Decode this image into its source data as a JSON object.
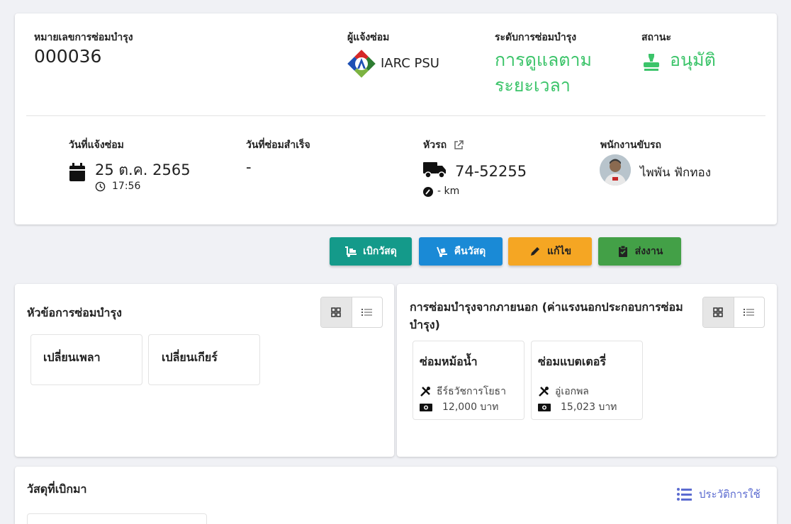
{
  "header": {
    "repair_no_label": "หมายเลขการซ่อมบำรุง",
    "repair_no": "000036",
    "reporter_label": "ผู้แจ้งซ่อม",
    "reporter_name": "IARC PSU",
    "level_label": "ระดับการซ่อมบำรุง",
    "level_line1": "การดูแลตาม",
    "level_line2": "ระยะเวลา",
    "status_label": "สถานะ",
    "status_value": "อนุมัติ",
    "accent": "#3cc46a"
  },
  "details": {
    "report_date_label": "วันที่แจ้งซ่อม",
    "report_date": "25 ต.ค. 2565",
    "report_time": "17:56",
    "done_date_label": "วันที่ซ่อมสำเร็จ",
    "done_date": "-",
    "truck_label": "หัวรถ",
    "truck_plate": "74-52255",
    "truck_km": "- km",
    "driver_label": "พนักงานขับรถ",
    "driver_name": "ไพพัน ฟักทอง"
  },
  "actions": {
    "withdraw": "เบิกวัสดุ",
    "return": "คืนวัสดุ",
    "edit": "แก้ไข",
    "submit": "ส่งงาน",
    "colors": {
      "withdraw": "#149a8a",
      "return": "#1a8ad6",
      "edit": "#f5a623",
      "submit": "#43a047"
    }
  },
  "topics": {
    "title": "หัวข้อการซ่อมบำรุง",
    "items": [
      {
        "label": "เปลี่ยนเพลา"
      },
      {
        "label": "เปลี่ยนเกียร์"
      }
    ]
  },
  "external": {
    "title_line1": "การซ่อมบำรุงจากภายนอก (ค่าแรงนอกประกอบการซ่อม",
    "title_line2": "บำรุง)",
    "items": [
      {
        "title": "ซ่อมหม้อน้ำ",
        "vendor": "ธีร์ธวัชการโยธา",
        "amount": "12,000 บาท"
      },
      {
        "title": "ซ่อมแบตเตอรี่",
        "vendor": "อู่เอกพล",
        "amount": "15,023 บาท"
      }
    ]
  },
  "materials": {
    "title": "วัสดุที่เบิกมา",
    "history_link": "ประวัติการใช้",
    "link_color": "#5b6bd0"
  }
}
